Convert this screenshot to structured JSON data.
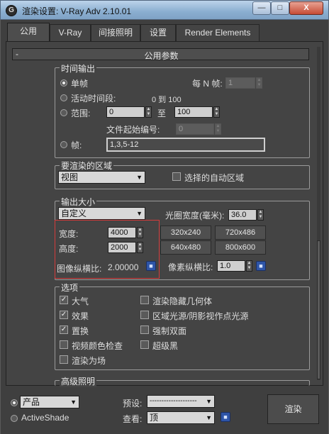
{
  "window": {
    "title": "渲染设置: V-Ray Adv 2.10.01",
    "icon_char": "G",
    "minimize": "—",
    "maximize": "□",
    "close": "X"
  },
  "tabs": [
    {
      "label": "公用",
      "active": true
    },
    {
      "label": "V-Ray",
      "active": false
    },
    {
      "label": "间接照明",
      "active": false
    },
    {
      "label": "设置",
      "active": false
    },
    {
      "label": "Render Elements",
      "active": false
    }
  ],
  "rollout": {
    "toggle": "-",
    "title": "公用参数"
  },
  "time_output": {
    "title": "时间输出",
    "single": "单帧",
    "every_n_label": "每 N 帧:",
    "every_n_value": "1",
    "active_segment": "活动时间段:",
    "active_range": "0 到 100",
    "range": "范围:",
    "range_start": "0",
    "range_to": "至",
    "range_end": "100",
    "file_start_label": "文件起始编号:",
    "file_start_value": "0",
    "frames": "帧:",
    "frames_value": "1,3,5-12",
    "selected_option": "single"
  },
  "render_area": {
    "title": "要渲染的区域",
    "mode": "视图",
    "auto_region": "选择的自动区域",
    "auto_region_checked": false
  },
  "output_size": {
    "title": "输出大小",
    "preset": "自定义",
    "aperture_label": "光圈宽度(毫米):",
    "aperture_value": "36.0",
    "width_label": "宽度:",
    "width_value": "4000",
    "height_label": "高度:",
    "height_value": "2000",
    "aspect_label": "图像纵横比:",
    "aspect_value": "2.00000",
    "pixel_aspect_label": "像素纵横比:",
    "pixel_aspect_value": "1.0",
    "presets": [
      "320x240",
      "720x486",
      "640x480",
      "800x600"
    ]
  },
  "options": {
    "title": "选项",
    "items": [
      {
        "label": "大气",
        "checked": true
      },
      {
        "label": "渲染隐藏几何体",
        "checked": false
      },
      {
        "label": "效果",
        "checked": true
      },
      {
        "label": "区域光源/阴影视作点光源",
        "checked": false
      },
      {
        "label": "置换",
        "checked": true
      },
      {
        "label": "强制双面",
        "checked": false
      },
      {
        "label": "视频颜色检查",
        "checked": false
      },
      {
        "label": "超级黑",
        "checked": false
      },
      {
        "label": "渲染为场",
        "checked": false
      }
    ]
  },
  "advanced_lighting": {
    "title": "高级照明"
  },
  "bottom": {
    "mode_product": "产品",
    "mode_activeshade": "ActiveShade",
    "preset_label": "预设:",
    "preset_value": "--------------------",
    "view_label": "查看:",
    "view_value": "顶",
    "render": "渲染"
  },
  "colors": {
    "highlight_box": "#d43c3c",
    "lock_icon": "#2e55a8"
  }
}
